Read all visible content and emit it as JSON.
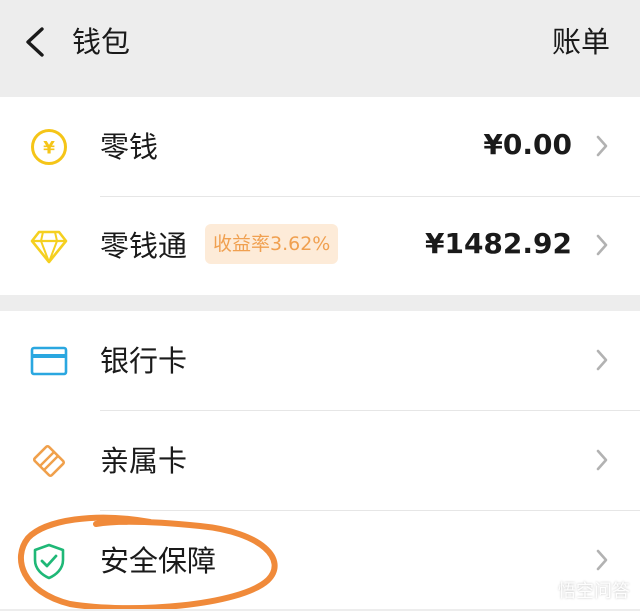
{
  "header": {
    "title": "钱包",
    "bill_label": "账单"
  },
  "balance_card": {
    "items": [
      {
        "label": "零钱",
        "value": "¥0.00"
      },
      {
        "label": "零钱通",
        "badge": "收益率3.62%",
        "value": "¥1482.92"
      }
    ]
  },
  "cards_section": {
    "items": [
      {
        "label": "银行卡"
      },
      {
        "label": "亲属卡"
      },
      {
        "label": "安全保障"
      }
    ]
  },
  "colors": {
    "coin": "#f5c518",
    "diamond": "#f5d020",
    "bank_card": "#2aa7e0",
    "family_card": "#f0a04b",
    "security": "#1fb877",
    "annotation": "#f08a3a",
    "badge_bg": "#fdebd8",
    "badge_text": "#f0a050"
  },
  "watermark": {
    "text": "悟空问答",
    "icon": "wukong-logo-icon"
  }
}
